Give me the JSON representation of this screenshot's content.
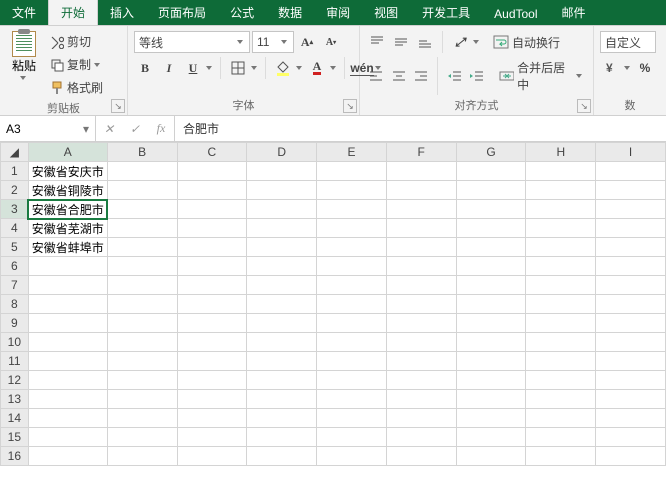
{
  "tabs": {
    "file": "文件",
    "home": "开始",
    "insert": "插入",
    "layout": "页面布局",
    "formulas": "公式",
    "data": "数据",
    "review": "审阅",
    "view": "视图",
    "dev": "开发工具",
    "aud": "AudTool",
    "mail": "邮件"
  },
  "clipboard": {
    "paste": "粘贴",
    "cut": "剪切",
    "copy": "复制",
    "format_painter": "格式刷",
    "group": "剪贴板"
  },
  "font": {
    "name": "等线",
    "size": "11",
    "group": "字体"
  },
  "align": {
    "wrap": "自动换行",
    "merge": "合并后居中",
    "group": "对齐方式"
  },
  "number": {
    "format": "自定义",
    "group": "数"
  },
  "namebox": "A3",
  "formula": "合肥市",
  "columns": [
    "A",
    "B",
    "C",
    "D",
    "E",
    "F",
    "G",
    "H",
    "I"
  ],
  "rows_count": 16,
  "selected": {
    "row": 3,
    "col": 0
  },
  "cells": {
    "r1c0": "安徽省安庆市",
    "r2c0": "安徽省铜陵市",
    "r3c0": "安徽省合肥市",
    "r4c0": "安徽省芜湖市",
    "r5c0": "安徽省蚌埠市"
  },
  "chart_data": null
}
